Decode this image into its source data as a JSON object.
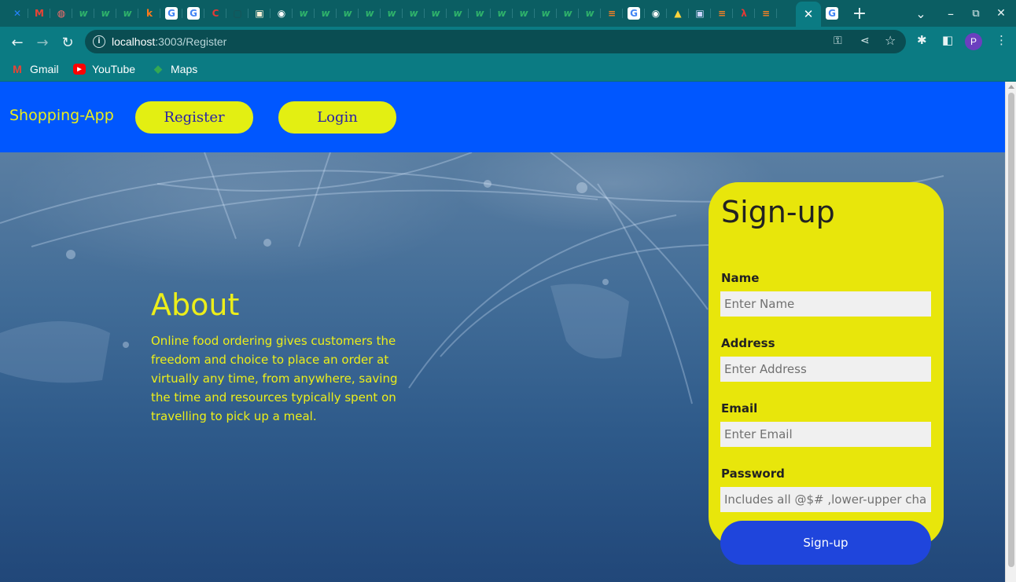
{
  "browser": {
    "tabs": [
      {
        "icon": "confluence-icon",
        "glyph": "✕",
        "color": "#2684ff"
      },
      {
        "icon": "gmail-icon",
        "glyph": "M",
        "color": "#ea4335"
      },
      {
        "icon": "flag-icon",
        "glyph": "◍",
        "color": "#ff6b6b"
      },
      {
        "icon": "w-icon",
        "glyph": "w",
        "color": "#2fb36b"
      },
      {
        "icon": "w-icon",
        "glyph": "w",
        "color": "#2fb36b"
      },
      {
        "icon": "w-icon",
        "glyph": "w",
        "color": "#2fb36b"
      },
      {
        "icon": "k-icon",
        "glyph": "k",
        "color": "#ff7a1a"
      },
      {
        "icon": "google-icon",
        "glyph": "G",
        "color": "#4285f4"
      },
      {
        "icon": "google-icon",
        "glyph": "G",
        "color": "#4285f4"
      },
      {
        "icon": "c-icon",
        "glyph": "C",
        "color": "#e53935"
      },
      {
        "icon": "blank-icon",
        "glyph": "▢",
        "color": "#1d4f53"
      },
      {
        "icon": "image-icon",
        "glyph": "▣",
        "color": "#f5f1d6"
      },
      {
        "icon": "chrome-icon",
        "glyph": "◉",
        "color": "#ffffff"
      },
      {
        "icon": "w-icon",
        "glyph": "w",
        "color": "#2fb36b"
      },
      {
        "icon": "w-icon",
        "glyph": "w",
        "color": "#2fb36b"
      },
      {
        "icon": "w-icon",
        "glyph": "w",
        "color": "#2fb36b"
      },
      {
        "icon": "w-icon",
        "glyph": "w",
        "color": "#2fb36b"
      },
      {
        "icon": "w-icon",
        "glyph": "w",
        "color": "#2fb36b"
      },
      {
        "icon": "w-icon",
        "glyph": "w",
        "color": "#2fb36b"
      },
      {
        "icon": "w-icon",
        "glyph": "w",
        "color": "#2fb36b"
      },
      {
        "icon": "w-icon",
        "glyph": "w",
        "color": "#2fb36b"
      },
      {
        "icon": "w-icon",
        "glyph": "w",
        "color": "#2fb36b"
      },
      {
        "icon": "w-icon",
        "glyph": "w",
        "color": "#2fb36b"
      },
      {
        "icon": "w-icon",
        "glyph": "w",
        "color": "#2fb36b"
      },
      {
        "icon": "w-icon",
        "glyph": "w",
        "color": "#2fb36b"
      },
      {
        "icon": "w-icon",
        "glyph": "w",
        "color": "#2fb36b"
      },
      {
        "icon": "w-icon",
        "glyph": "w",
        "color": "#2fb36b"
      },
      {
        "icon": "stackoverflow-icon",
        "glyph": "≡",
        "color": "#f48024"
      },
      {
        "icon": "google-icon",
        "glyph": "G",
        "color": "#4285f4"
      },
      {
        "icon": "chrome-icon",
        "glyph": "◉",
        "color": "#ffffff"
      },
      {
        "icon": "linux-icon",
        "glyph": "▲",
        "color": "#ffd43b"
      },
      {
        "icon": "image-icon",
        "glyph": "▣",
        "color": "#c9d6ff"
      },
      {
        "icon": "stackoverflow-icon",
        "glyph": "≡",
        "color": "#f48024"
      },
      {
        "icon": "figure-icon",
        "glyph": "λ",
        "color": "#e53935"
      },
      {
        "icon": "stackoverflow-icon",
        "glyph": "≡",
        "color": "#f48024"
      }
    ],
    "active_tab_close": "✕",
    "after_active_tab": {
      "icon": "google-icon",
      "glyph": "G",
      "color": "#4285f4"
    },
    "new_tab": "+",
    "window_controls": {
      "dropdown": "⌄",
      "minimize": "–",
      "restore": "⧉",
      "close": "✕"
    },
    "nav": {
      "back": "←",
      "forward": "→",
      "reload": "↻"
    },
    "url_host": "localhost",
    "url_path": ":3003/Register",
    "profile_initial": "P",
    "bookmarks": [
      {
        "label": "Gmail",
        "icon": "gmail-icon",
        "glyph": "M"
      },
      {
        "label": "YouTube",
        "icon": "youtube-icon",
        "glyph": "▶"
      },
      {
        "label": "Maps",
        "icon": "maps-icon",
        "glyph": "◆"
      }
    ]
  },
  "app": {
    "brand": "Shopping-App",
    "nav": {
      "register": "Register",
      "login": "Login"
    },
    "about": {
      "title": "About",
      "text": "Online food ordering gives customers the freedom and choice to place an order at virtually any time, from anywhere, saving the time and resources typically spent on travelling to pick up a meal."
    },
    "form": {
      "title": "Sign-up",
      "name_label": "Name",
      "name_placeholder": "Enter Name",
      "address_label": "Address",
      "address_placeholder": "Enter Address",
      "email_label": "Email",
      "email_placeholder": "Enter Email",
      "password_label": "Password",
      "password_placeholder": "Includes all @$# ,lower-upper characters",
      "submit": "Sign-up"
    }
  },
  "colors": {
    "chrome_frame": "#0b5e63",
    "chrome_toolbar": "#0b7b83",
    "app_nav": "#0057ff",
    "accent_yellow": "#e3ef12",
    "card_yellow": "#e8e60b",
    "signup_button": "#1f45dc"
  }
}
